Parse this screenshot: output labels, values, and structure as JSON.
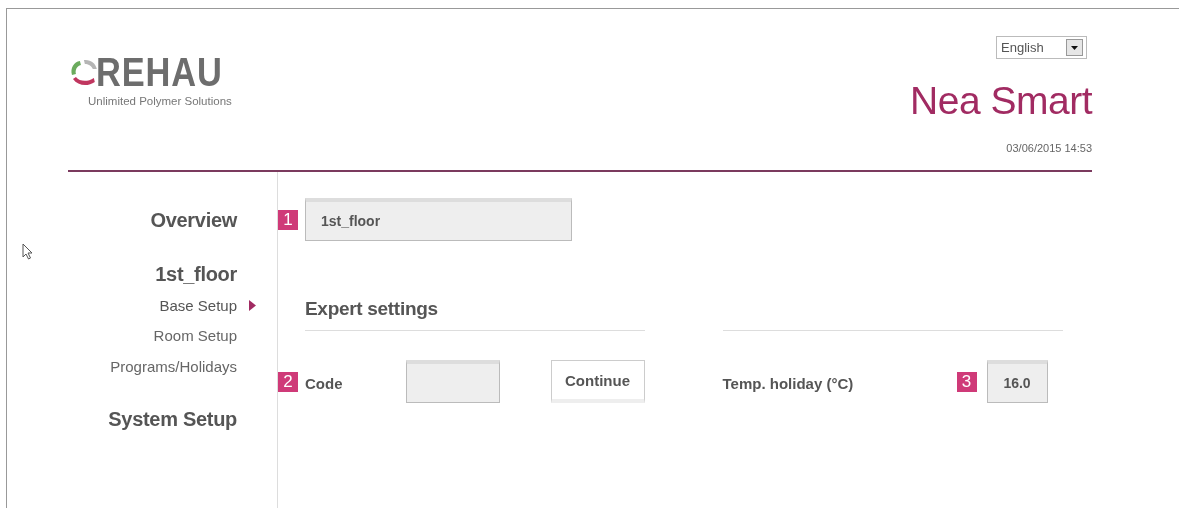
{
  "language_select": {
    "value": "English"
  },
  "logo": {
    "brand": "REHAU",
    "tagline": "Unlimited Polymer Solutions"
  },
  "app_title": "Nea Smart",
  "datetime": "03/06/2015 14:53",
  "sidebar": {
    "items": [
      {
        "label": "Overview",
        "kind": "section"
      },
      {
        "label": "1st_floor",
        "kind": "section",
        "children": [
          {
            "label": "Base Setup",
            "selected": true
          },
          {
            "label": "Room Setup",
            "selected": false
          },
          {
            "label": "Programs/Holidays",
            "selected": false
          }
        ]
      },
      {
        "label": "System Setup",
        "kind": "section"
      }
    ]
  },
  "name_field": {
    "marker": "1",
    "value": "1st_floor"
  },
  "expert_settings": {
    "title": "Expert settings",
    "code": {
      "marker": "2",
      "label": "Code"
    },
    "continue_button": "Continue",
    "temp_holiday": {
      "label": "Temp. holiday (°C)",
      "marker": "3",
      "value": "16.0"
    }
  }
}
